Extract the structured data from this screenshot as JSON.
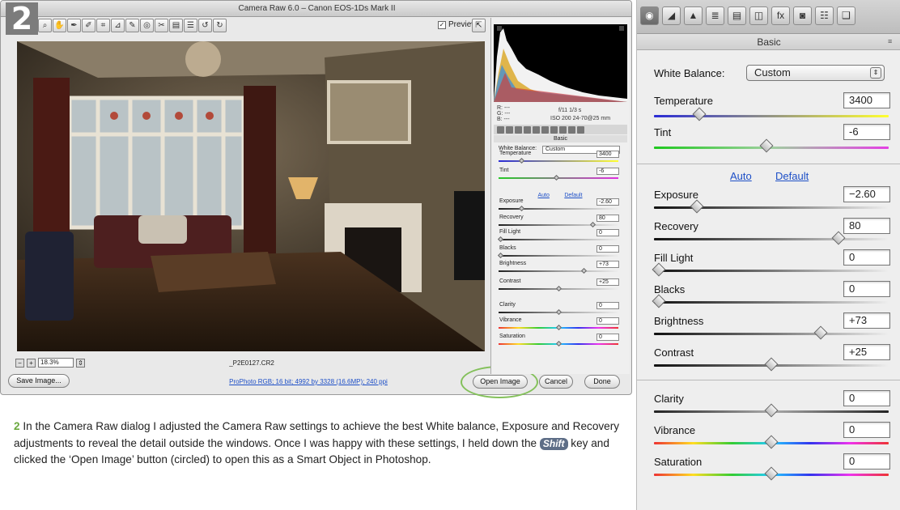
{
  "dialog": {
    "title": "Camera Raw 6.0  –  Canon EOS-1Ds Mark II",
    "step_number": "2",
    "preview_label": "Preview",
    "zoom_value": "18.3%",
    "filename": "_P2E0127.CR2",
    "workflow_link": "ProPhoto RGB; 16 bit; 4992 by 3328 (16.6MP); 240 ppi",
    "save_image_label": "Save Image...",
    "open_image_label": "Open Image",
    "cancel_label": "Cancel",
    "done_label": "Done",
    "tools": [
      "⌕",
      "✋",
      "✒",
      "✐",
      "⌗",
      "⊿",
      "✎",
      "◎",
      "✂",
      "▤",
      "☰",
      "↺",
      "↻"
    ]
  },
  "small_panel": {
    "info": {
      "r": "R:  ---",
      "g": "G:  ---",
      "b": "B:  ---",
      "aperture": "f/11   1/3 s",
      "iso": "ISO 200   24-70@25 mm"
    },
    "section_title": "Basic",
    "white_balance_label": "White Balance:",
    "white_balance_value": "Custom",
    "auto_label": "Auto",
    "default_label": "Default",
    "sliders": [
      {
        "label": "Temperature",
        "value": "3400",
        "pos": 0.18,
        "gradient": "linear-gradient(90deg,#2a2bd6,#ffff30)"
      },
      {
        "label": "Tint",
        "value": "-6",
        "pos": 0.48,
        "gradient": "linear-gradient(90deg,#27c927,#e030e0)"
      },
      {
        "label": "Exposure",
        "value": "-2.60",
        "pos": 0.18,
        "gradient": ""
      },
      {
        "label": "Recovery",
        "value": "80",
        "pos": 0.8,
        "gradient": ""
      },
      {
        "label": "Fill Light",
        "value": "0",
        "pos": 0.0,
        "gradient": ""
      },
      {
        "label": "Blacks",
        "value": "0",
        "pos": 0.0,
        "gradient": ""
      },
      {
        "label": "Brightness",
        "value": "+73",
        "pos": 0.72,
        "gradient": ""
      },
      {
        "label": "Contrast",
        "value": "+25",
        "pos": 0.5,
        "gradient": ""
      },
      {
        "label": "Clarity",
        "value": "0",
        "pos": 0.5,
        "gradient": ""
      },
      {
        "label": "Vibrance",
        "value": "0",
        "pos": 0.5,
        "gradient": "rainbow"
      },
      {
        "label": "Saturation",
        "value": "0",
        "pos": 0.5,
        "gradient": "rainbow"
      }
    ]
  },
  "big_panel": {
    "section_title": "Basic",
    "tabs": [
      "◉",
      "◢",
      "▲",
      "≣",
      "▤",
      "◫",
      "fx",
      "◙",
      "☷",
      "❑"
    ],
    "white_balance_label": "White Balance:",
    "white_balance_value": "Custom",
    "temperature": {
      "label": "Temperature",
      "value": "3400",
      "pos": 0.18
    },
    "tint": {
      "label": "Tint",
      "value": "-6",
      "pos": 0.48
    },
    "auto_label": "Auto",
    "default_label": "Default",
    "tone": [
      {
        "label": "Exposure",
        "value": "−2.60",
        "pos": 0.17
      },
      {
        "label": "Recovery",
        "value": "80",
        "pos": 0.8
      },
      {
        "label": "Fill Light",
        "value": "0",
        "pos": 0.0
      },
      {
        "label": "Blacks",
        "value": "0",
        "pos": 0.0
      },
      {
        "label": "Brightness",
        "value": "+73",
        "pos": 0.72
      },
      {
        "label": "Contrast",
        "value": "+25",
        "pos": 0.5
      }
    ],
    "presence": [
      {
        "label": "Clarity",
        "value": "0",
        "pos": 0.5
      },
      {
        "label": "Vibrance",
        "value": "0",
        "pos": 0.5
      },
      {
        "label": "Saturation",
        "value": "0",
        "pos": 0.5
      }
    ]
  },
  "caption": {
    "number": "2",
    "part1": " In the Camera Raw dialog I adjusted the Camera Raw settings to achieve the best White balance, Exposure and Recovery adjustments to reveal the detail outside the windows. Once I was happy with these settings, I held down the ",
    "key": "Shift",
    "part2": " key and clicked the ‘Open Image’ button (circled) to open this as a Smart Object in Photoshop."
  },
  "colors": {
    "accent_green": "#83c05a",
    "link_blue": "#1d4fc7",
    "key_badge": "#5e6e87"
  }
}
